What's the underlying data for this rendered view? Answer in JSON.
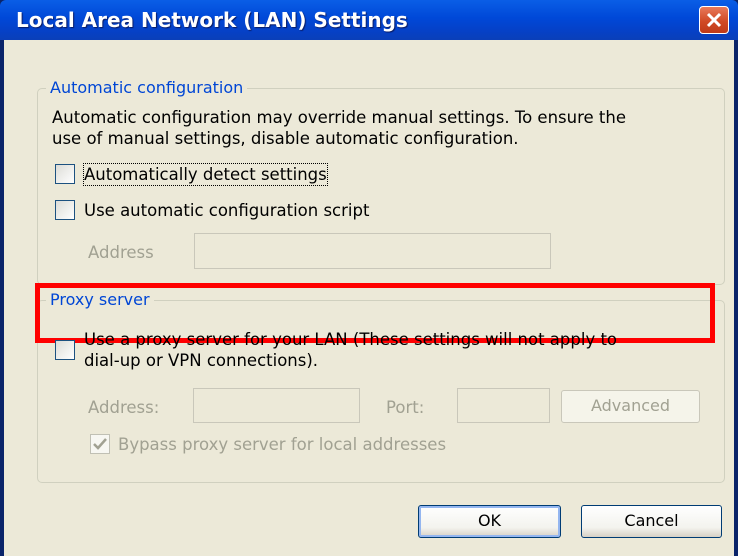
{
  "window": {
    "title": "Local Area Network (LAN) Settings",
    "close_icon": "close-x-icon"
  },
  "auto_config": {
    "legend": "Automatic configuration",
    "description_line1": "Automatic configuration may override manual settings.  To ensure the",
    "description_line2": "use of manual settings, disable automatic configuration.",
    "auto_detect_label": "Automatically detect settings",
    "auto_detect_checked": false,
    "use_script_label": "Use automatic configuration script",
    "use_script_checked": false,
    "address_label": "Address",
    "address_value": ""
  },
  "proxy": {
    "legend": "Proxy server",
    "use_proxy_line1": "Use a proxy server for your LAN (These settings will not apply to",
    "use_proxy_line2": "dial-up or VPN connections).",
    "use_proxy_checked": false,
    "address_label": "Address:",
    "address_value": "",
    "port_label": "Port:",
    "port_value": "",
    "advanced_label": "Advanced",
    "bypass_label": "Bypass proxy server for local addresses",
    "bypass_checked": true
  },
  "buttons": {
    "ok_label": "OK",
    "cancel_label": "Cancel"
  },
  "colors": {
    "titlebar": "#0048d8",
    "client_bg": "#ece9d8",
    "legend_text": "#0046d5",
    "highlight": "#ff0000",
    "close_button": "#d14a25"
  }
}
